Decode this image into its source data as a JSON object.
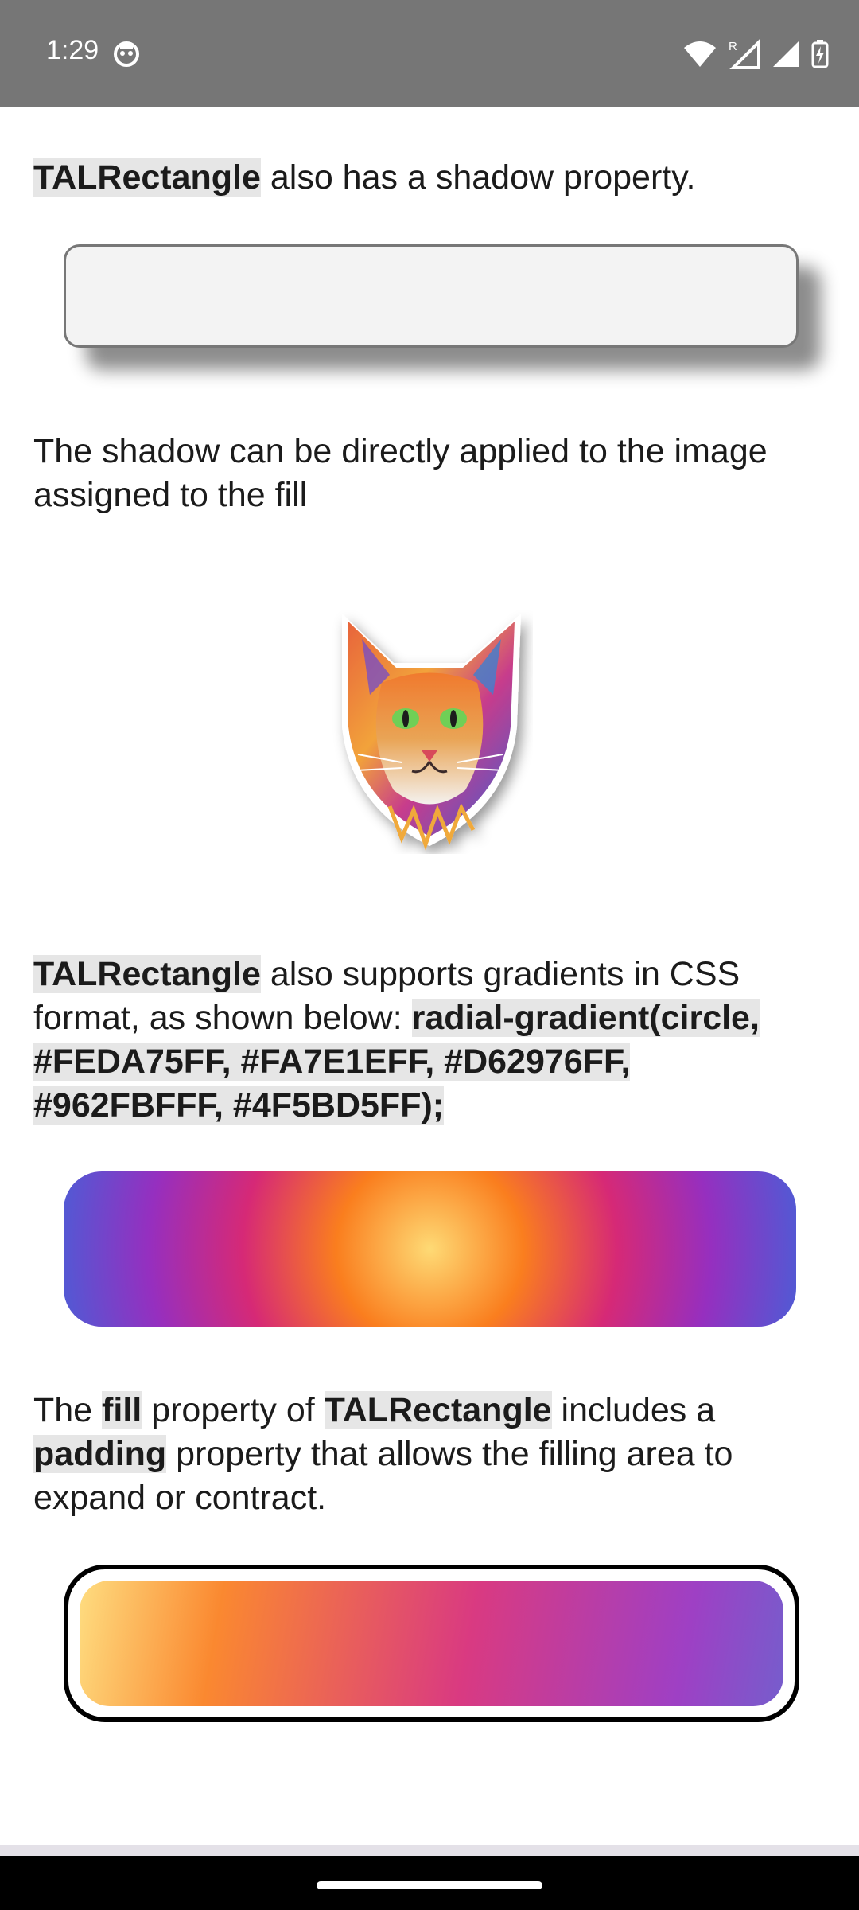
{
  "status_bar": {
    "time": "1:29",
    "app_icon": "robot-face-icon",
    "icons": [
      "wifi-icon",
      "signal-roaming-icon",
      "signal-icon",
      "battery-charging-icon"
    ],
    "roaming_indicator": "R"
  },
  "section_shadow": {
    "class_name": "TALRectangle",
    "text_after": " also has a shadow property."
  },
  "section_image_shadow": {
    "text": "The shadow can be directly applied to the image assigned to the fill",
    "image": "colorful-cat-head-illustration"
  },
  "section_gradient": {
    "class_name": "TALRectangle",
    "text_middle": " also supports gradients in CSS format, as shown below: ",
    "gradient_code": "radial-gradient(circle, #FEDA75FF, #FA7E1EFF, #D62976FF, #962FBFFF, #4F5BD5FF);",
    "colors": [
      "#FEDA75",
      "#FA7E1E",
      "#D62976",
      "#962FBF",
      "#4F5BD5"
    ]
  },
  "section_padding": {
    "text_1": "The ",
    "code_fill": "fill",
    "text_2": " property of ",
    "class_name": "TALRectangle",
    "text_3": " includes a ",
    "code_padding": "padding",
    "text_4": " property that allows the filling area to expand or contract."
  },
  "colors": {
    "status_bar_bg": "#767676",
    "code_highlight": "#e6e6e6",
    "shadow_rect_fill": "#f3f3f3",
    "nav_bar": "#000000"
  }
}
